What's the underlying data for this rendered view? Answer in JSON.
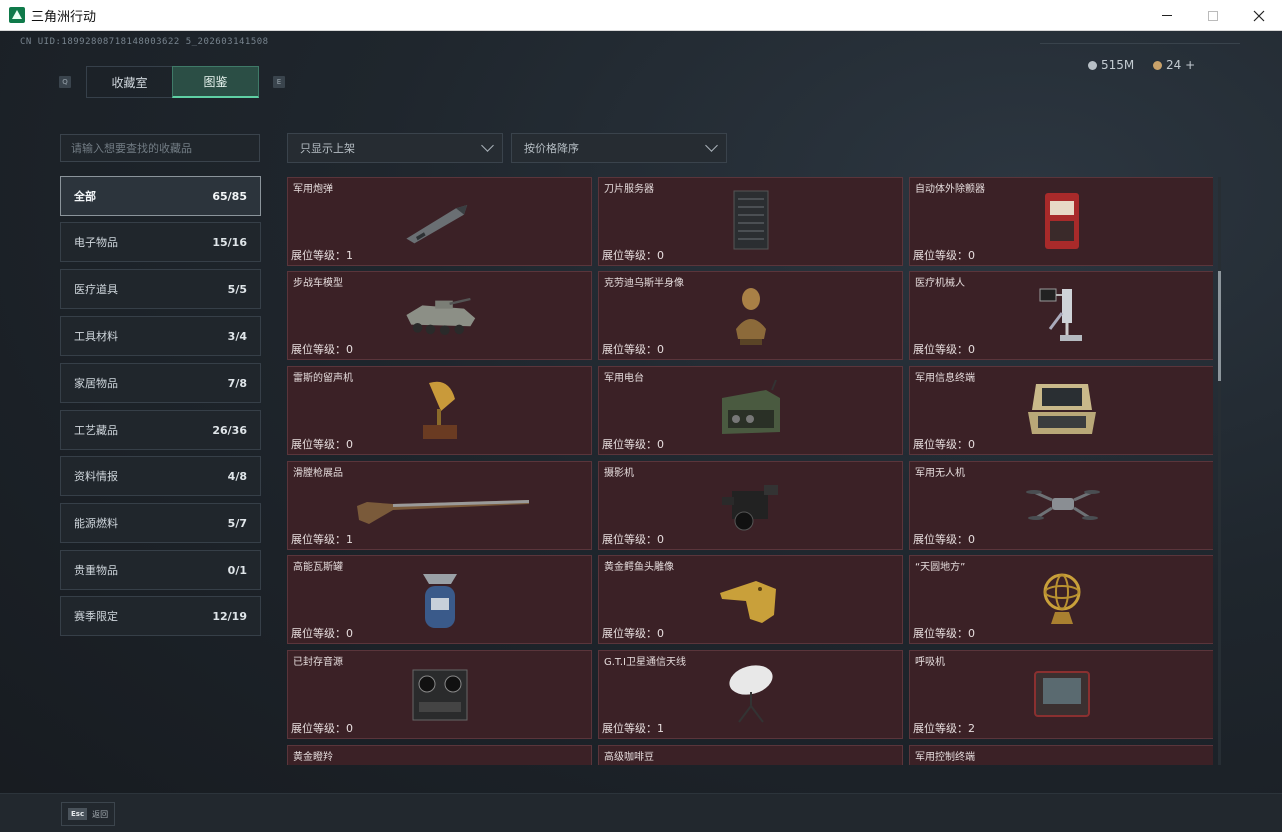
{
  "window": {
    "title": "三角洲行动"
  },
  "uid": "CN UID:18992808718148003622 5_202603141508",
  "tabs": {
    "left_key": "Q",
    "right_key": "E",
    "items": [
      {
        "label": "收藏室"
      },
      {
        "label": "图鉴"
      }
    ]
  },
  "currency": {
    "coins": "515M",
    "tokens": "24 +"
  },
  "search": {
    "placeholder": "请输入想要查找的收藏品"
  },
  "filters": {
    "shelf": "只显示上架",
    "sort": "按价格降序"
  },
  "categories": [
    {
      "label": "全部",
      "count": "65/85"
    },
    {
      "label": "电子物品",
      "count": "15/16"
    },
    {
      "label": "医疗道具",
      "count": "5/5"
    },
    {
      "label": "工具材料",
      "count": "3/4"
    },
    {
      "label": "家居物品",
      "count": "7/8"
    },
    {
      "label": "工艺藏品",
      "count": "26/36"
    },
    {
      "label": "资料情报",
      "count": "4/8"
    },
    {
      "label": "能源燃料",
      "count": "5/7"
    },
    {
      "label": "贵重物品",
      "count": "0/1"
    },
    {
      "label": "赛季限定",
      "count": "12/19"
    }
  ],
  "items": [
    {
      "name": "军用炮弹",
      "level": "展位等级：1",
      "icon": "shell-icon"
    },
    {
      "name": "刀片服务器",
      "level": "展位等级：0",
      "icon": "server-icon"
    },
    {
      "name": "自动体外除颤器",
      "level": "展位等级：0",
      "icon": "defibrillator-icon"
    },
    {
      "name": "步战车模型",
      "level": "展位等级：0",
      "icon": "armored-vehicle-icon"
    },
    {
      "name": "克劳迪乌斯半身像",
      "level": "展位等级：0",
      "icon": "bust-icon"
    },
    {
      "name": "医疗机械人",
      "level": "展位等级：0",
      "icon": "medical-robot-icon"
    },
    {
      "name": "雷斯的留声机",
      "level": "展位等级：0",
      "icon": "gramophone-icon"
    },
    {
      "name": "军用电台",
      "level": "展位等级：0",
      "icon": "radio-icon"
    },
    {
      "name": "军用信息终端",
      "level": "展位等级：0",
      "icon": "rugged-terminal-icon"
    },
    {
      "name": "滑膛枪展品",
      "level": "展位等级：1",
      "icon": "musket-icon"
    },
    {
      "name": "摄影机",
      "level": "展位等级：0",
      "icon": "camera-icon"
    },
    {
      "name": "军用无人机",
      "level": "展位等级：0",
      "icon": "drone-icon"
    },
    {
      "name": "高能瓦斯罐",
      "level": "展位等级：0",
      "icon": "gas-canister-icon"
    },
    {
      "name": "黄金鳄鱼头雕像",
      "level": "展位等级：0",
      "icon": "gold-crocodile-icon"
    },
    {
      "name": "“天圆地方”",
      "level": "展位等级：0",
      "icon": "armillary-sphere-icon"
    },
    {
      "name": "已封存音源",
      "level": "展位等级：0",
      "icon": "tape-recorder-icon"
    },
    {
      "name": "G.T.I卫星通信天线",
      "level": "展位等级：1",
      "icon": "satellite-dish-icon"
    },
    {
      "name": "呼吸机",
      "level": "展位等级：2",
      "icon": "ventilator-icon"
    },
    {
      "name": "黄金瞪羚",
      "level": "",
      "icon": "gold-gazelle-icon"
    },
    {
      "name": "高级咖啡豆",
      "level": "",
      "icon": "coffee-beans-icon"
    },
    {
      "name": "军用控制终端",
      "level": "",
      "icon": "control-terminal-icon"
    }
  ],
  "footer": {
    "esc_key": "Esc",
    "esc_label": "返回"
  }
}
